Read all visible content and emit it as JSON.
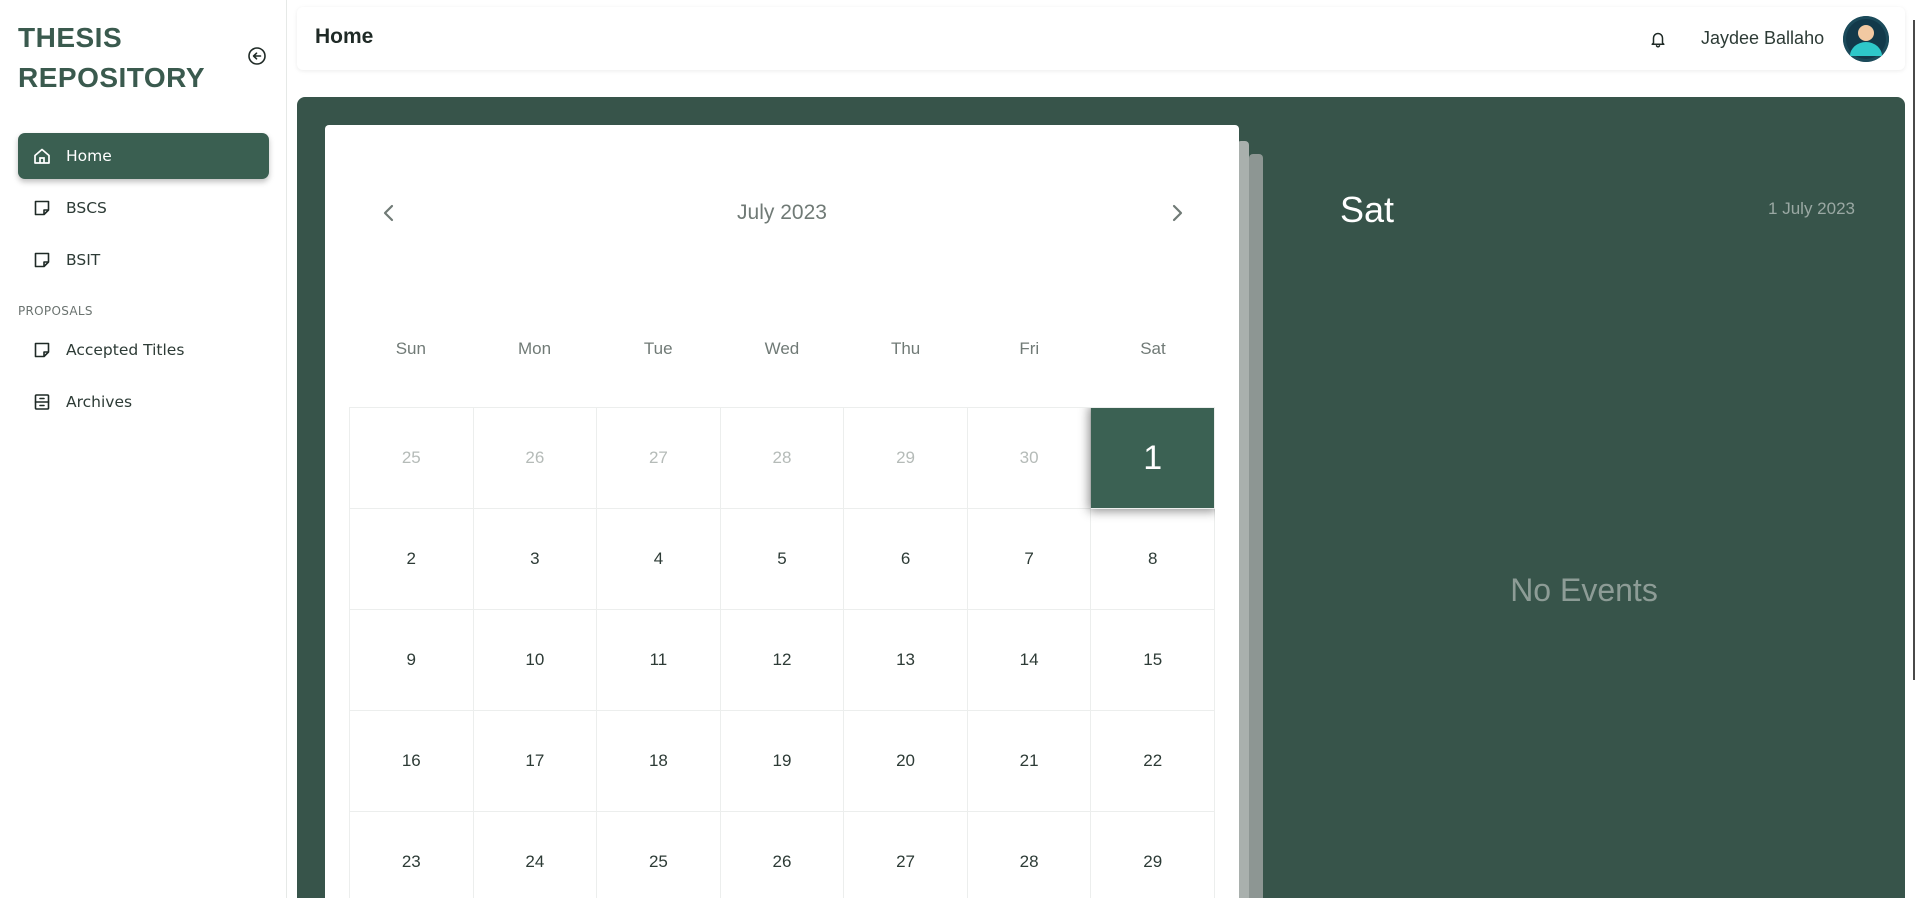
{
  "sidebar": {
    "brand_line1": "THESIS",
    "brand_line2": "REPOSITORY",
    "collapse_icon": "circle-arrow-left-icon",
    "items": [
      {
        "label": "Home",
        "icon": "home-icon",
        "active": true
      },
      {
        "label": "BSCS",
        "icon": "note-icon"
      },
      {
        "label": "BSIT",
        "icon": "note-icon"
      }
    ],
    "section_label": "PROPOSALS",
    "proposal_items": [
      {
        "label": "Accepted Titles",
        "icon": "note-icon"
      },
      {
        "label": "Archives",
        "icon": "archive-icon"
      }
    ]
  },
  "header": {
    "title": "Home",
    "bell_icon": "bell-icon",
    "user_name": "Jaydee Ballaho"
  },
  "calendar": {
    "month_label": "July 2023",
    "weekdays": [
      "Sun",
      "Mon",
      "Tue",
      "Wed",
      "Thu",
      "Fri",
      "Sat"
    ],
    "days": [
      {
        "n": "25",
        "muted": true
      },
      {
        "n": "26",
        "muted": true
      },
      {
        "n": "27",
        "muted": true
      },
      {
        "n": "28",
        "muted": true
      },
      {
        "n": "29",
        "muted": true
      },
      {
        "n": "30",
        "muted": true
      },
      {
        "n": "1",
        "selected": true
      },
      {
        "n": "2"
      },
      {
        "n": "3"
      },
      {
        "n": "4"
      },
      {
        "n": "5"
      },
      {
        "n": "6"
      },
      {
        "n": "7"
      },
      {
        "n": "8"
      },
      {
        "n": "9"
      },
      {
        "n": "10"
      },
      {
        "n": "11"
      },
      {
        "n": "12"
      },
      {
        "n": "13"
      },
      {
        "n": "14"
      },
      {
        "n": "15"
      },
      {
        "n": "16"
      },
      {
        "n": "17"
      },
      {
        "n": "18"
      },
      {
        "n": "19"
      },
      {
        "n": "20"
      },
      {
        "n": "21"
      },
      {
        "n": "22"
      },
      {
        "n": "23"
      },
      {
        "n": "24"
      },
      {
        "n": "25"
      },
      {
        "n": "26"
      },
      {
        "n": "27"
      },
      {
        "n": "28"
      },
      {
        "n": "29"
      }
    ]
  },
  "events_panel": {
    "day_name": "Sat",
    "date_label": "1 July 2023",
    "empty_text": "No Events"
  },
  "colors": {
    "brand": "#3a5a4e",
    "panel_green": "#37544a",
    "selected_day": "#3b6153"
  }
}
